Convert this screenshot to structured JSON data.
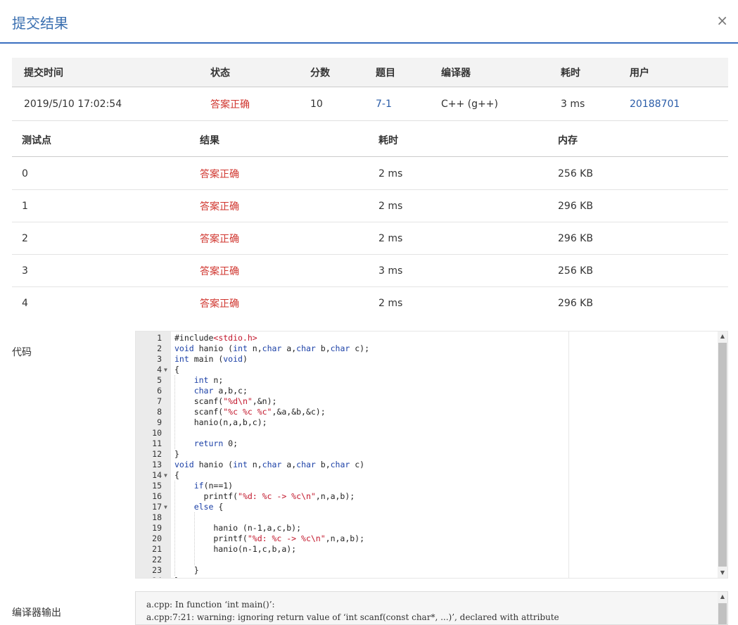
{
  "dialog": {
    "title": "提交结果",
    "close": "×"
  },
  "summary": {
    "headers": [
      "提交时间",
      "状态",
      "分数",
      "题目",
      "编译器",
      "耗时",
      "用户"
    ],
    "row": {
      "time": "2019/5/10 17:02:54",
      "status": "答案正确",
      "score": "10",
      "problem": "7-1",
      "compiler": "C++ (g++)",
      "duration": "3 ms",
      "user": "20188701"
    }
  },
  "cases": {
    "headers": [
      "测试点",
      "结果",
      "耗时",
      "内存"
    ],
    "rows": [
      {
        "id": "0",
        "result": "答案正确",
        "time": "2 ms",
        "memory": "256 KB"
      },
      {
        "id": "1",
        "result": "答案正确",
        "time": "2 ms",
        "memory": "296 KB"
      },
      {
        "id": "2",
        "result": "答案正确",
        "time": "2 ms",
        "memory": "296 KB"
      },
      {
        "id": "3",
        "result": "答案正确",
        "time": "3 ms",
        "memory": "256 KB"
      },
      {
        "id": "4",
        "result": "答案正确",
        "time": "2 ms",
        "memory": "296 KB"
      }
    ]
  },
  "code_label": "代码",
  "compiler_output_label": "编译器输出",
  "code_lines": [
    "#include<stdio.h>",
    "void hanio (int n,char a,char b,char c);",
    "int main (void)",
    "{",
    "    int n;",
    "    char a,b,c;",
    "    scanf(\"%d\\n\",&n);",
    "    scanf(\"%c %c %c\",&a,&b,&c);",
    "    hanio(n,a,b,c);",
    "",
    "    return 0;",
    "}",
    "void hanio (int n,char a,char b,char c)",
    "{",
    "    if(n==1)",
    "      printf(\"%d: %c -> %c\\n\",n,a,b);",
    "    else {",
    "",
    "        hanio (n-1,a,c,b);",
    "        printf(\"%d: %c -> %c\\n\",n,a,b);",
    "        hanio(n-1,c,b,a);",
    "",
    "    }",
    "}"
  ],
  "compiler_output": [
    "a.cpp: In function ‘int main()’:",
    "a.cpp:7:21: warning: ignoring return value of ‘int scanf(const char*, ...)’, declared with attribute"
  ],
  "colors": {
    "accent": "#3a6fc0",
    "success": "#d0352e",
    "link": "#2a5ca8"
  }
}
